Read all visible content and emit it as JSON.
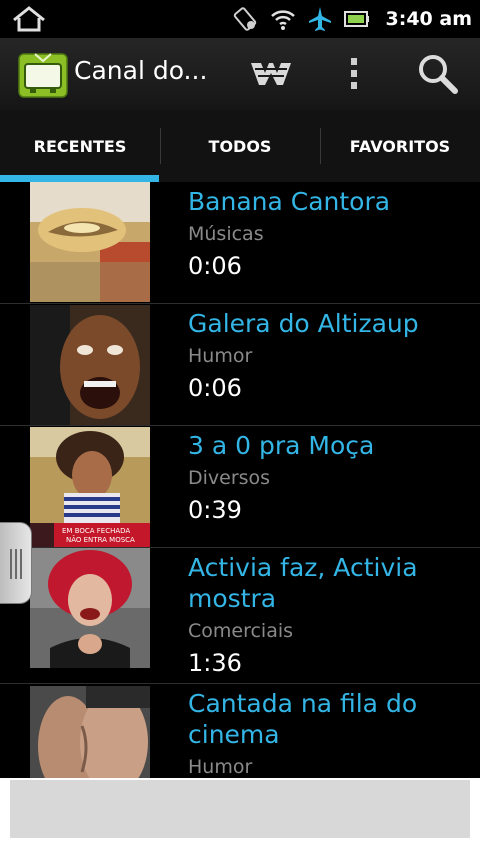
{
  "status_bar": {
    "time": "3:40 am",
    "icons": [
      "home-icon",
      "rotation-lock-icon",
      "wifi-icon",
      "airplane-mode-icon",
      "battery-icon"
    ]
  },
  "action_bar": {
    "app_title": "Canal do...",
    "icons": [
      "app-tv-icon",
      "channel-logo-icon",
      "overflow-menu-icon",
      "search-icon"
    ]
  },
  "tabs": [
    {
      "label": "RECENTES",
      "active": true
    },
    {
      "label": "TODOS",
      "active": false
    },
    {
      "label": "FAVORITOS",
      "active": false
    }
  ],
  "accent_color": "#33b5e5",
  "videos": [
    {
      "title": "Banana Cantora",
      "category": "Músicas",
      "duration": "0:06"
    },
    {
      "title": "Galera do Altizaup",
      "category": "Humor",
      "duration": "0:06"
    },
    {
      "title": "3 a 0 pra Moça",
      "category": "Diversos",
      "duration": "0:39",
      "thumb_caption": "EM BOCA FECHADA NÃO ENTRA MOSCA"
    },
    {
      "title": "Activia faz, Activia mostra",
      "category": "Comerciais",
      "duration": "1:36"
    },
    {
      "title": "Cantada na fila do cinema",
      "category": "Humor",
      "duration": ""
    }
  ]
}
